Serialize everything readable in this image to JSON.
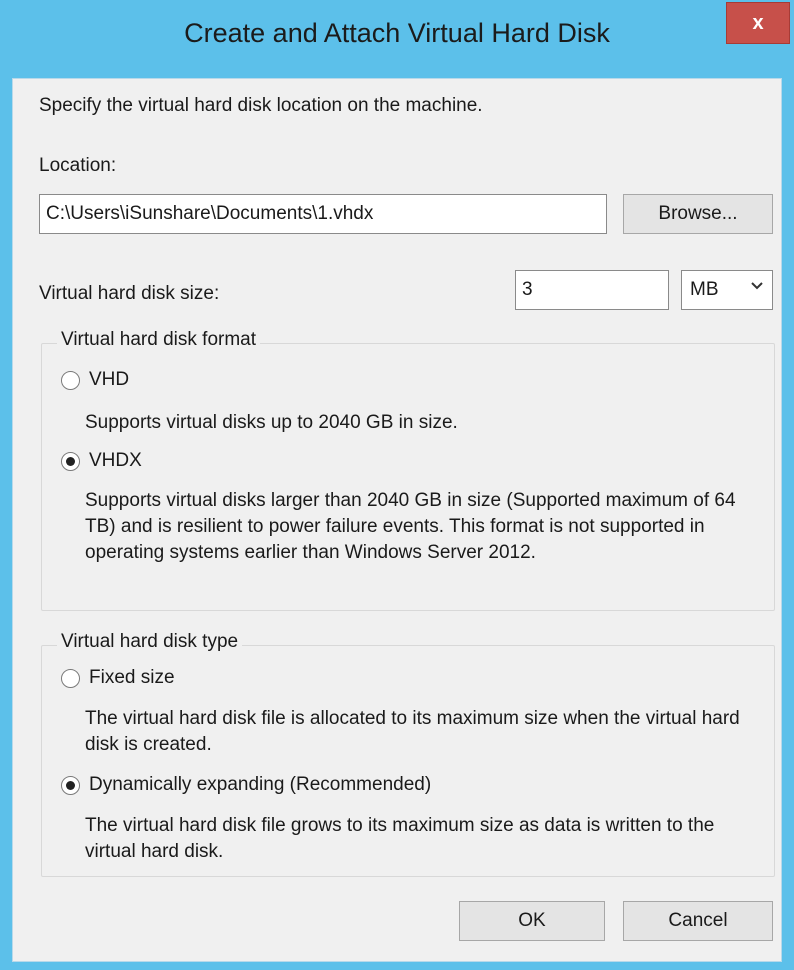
{
  "window": {
    "title": "Create and Attach Virtual Hard Disk",
    "close_label": "x"
  },
  "intro": "Specify the virtual hard disk location on the machine.",
  "location": {
    "label": "Location:",
    "value": "C:\\Users\\iSunshare\\Documents\\1.vhdx",
    "browse_label": "Browse..."
  },
  "size": {
    "label": "Virtual hard disk size:",
    "value": "3",
    "unit": "MB"
  },
  "format": {
    "legend": "Virtual hard disk format",
    "vhd_label": "VHD",
    "vhd_desc": "Supports virtual disks up to 2040 GB in size.",
    "vhdx_label": "VHDX",
    "vhdx_desc": "Supports virtual disks larger than 2040 GB in size (Supported maximum of 64 TB) and is resilient to power failure events. This format is not supported in operating systems earlier than Windows Server 2012.",
    "selected": "VHDX"
  },
  "type": {
    "legend": "Virtual hard disk type",
    "fixed_label": "Fixed size",
    "fixed_desc": "The virtual hard disk file is allocated to its maximum size when the virtual hard disk is created.",
    "dynamic_label": "Dynamically expanding (Recommended)",
    "dynamic_desc": "The virtual hard disk file grows to its maximum size as data is written to the virtual hard disk.",
    "selected": "Dynamically expanding (Recommended)"
  },
  "buttons": {
    "ok": "OK",
    "cancel": "Cancel"
  },
  "colors": {
    "frame": "#5cc0ea",
    "close_button": "#c7504a",
    "client_background": "#f0f0f0"
  }
}
